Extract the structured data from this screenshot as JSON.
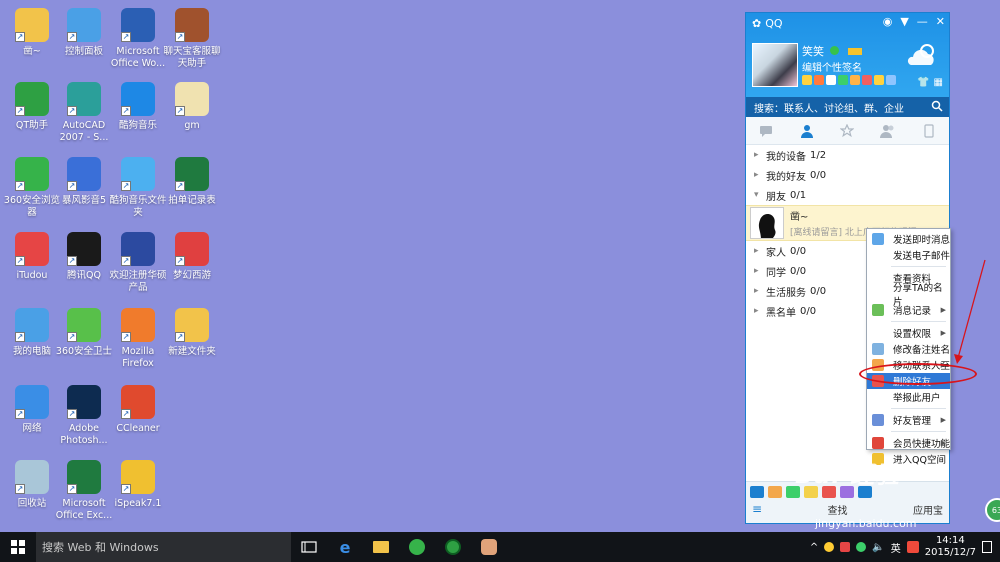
{
  "desktop": {
    "icons": [
      {
        "label": "凿~",
        "icon": "folder-user-icon"
      },
      {
        "label": "控制面板",
        "icon": "control-panel-icon"
      },
      {
        "label": "Microsoft Office Wo...",
        "icon": "word-icon"
      },
      {
        "label": "聊天宝客服聊天助手",
        "icon": "bear-icon"
      },
      {
        "label": "QT助手",
        "icon": "qt-icon"
      },
      {
        "label": "AutoCAD 2007 - S...",
        "icon": "autocad-icon"
      },
      {
        "label": "酷狗音乐",
        "icon": "kugou-icon"
      },
      {
        "label": "gm",
        "icon": "file-icon"
      },
      {
        "label": "360安全浏览器",
        "icon": "360-browser-icon"
      },
      {
        "label": "暴风影音5",
        "icon": "baofeng-icon"
      },
      {
        "label": "酷狗音乐文件夹",
        "icon": "kugou-folder-icon"
      },
      {
        "label": "拍单记录表",
        "icon": "excel-icon"
      },
      {
        "label": "iTudou",
        "icon": "itudou-icon"
      },
      {
        "label": "腾讯QQ",
        "icon": "qq-penguin-icon"
      },
      {
        "label": "欢迎注册华硕产品",
        "icon": "asus-icon"
      },
      {
        "label": "梦幻西游",
        "icon": "game-icon"
      },
      {
        "label": "我的电脑",
        "icon": "computer-icon"
      },
      {
        "label": "360安全卫士",
        "icon": "360-guard-icon"
      },
      {
        "label": "Mozilla Firefox",
        "icon": "firefox-icon"
      },
      {
        "label": "新建文件夹",
        "icon": "folder-icon"
      },
      {
        "label": "网络",
        "icon": "network-icon"
      },
      {
        "label": "Adobe Photosh...",
        "icon": "photoshop-icon"
      },
      {
        "label": "CCleaner",
        "icon": "ccleaner-icon"
      },
      {
        "label": "回收站",
        "icon": "recycle-bin-icon"
      },
      {
        "label": "Microsoft Office Exc...",
        "icon": "excel-icon"
      },
      {
        "label": "iSpeak7.1",
        "icon": "ispeak-icon"
      }
    ]
  },
  "taskbar": {
    "search_placeholder": "搜索 Web 和 Windows",
    "ime": "英",
    "time": "14:14",
    "date": "2015/12/7"
  },
  "qq": {
    "title": "QQ",
    "nickname": "笑笑",
    "signature": "编辑个性签名",
    "search_placeholder": "搜索：联系人、讨论组、群、企业",
    "groups": [
      {
        "name": "我的设备",
        "count": "1/2",
        "expanded": false
      },
      {
        "name": "我的好友",
        "count": "0/0",
        "expanded": false
      },
      {
        "name": "朋友",
        "count": "0/1",
        "expanded": true
      },
      {
        "name": "家人",
        "count": "0/0",
        "expanded": false
      },
      {
        "name": "同学",
        "count": "0/0",
        "expanded": false
      },
      {
        "name": "生活服务",
        "count": "0/0",
        "expanded": false
      },
      {
        "name": "黑名单",
        "count": "0/0",
        "expanded": false
      }
    ],
    "friend": {
      "name": "凿~",
      "message": "[离线请留言] 北上广不相信眼泪"
    },
    "bottom": {
      "find_label": "查找",
      "app_label": "应用宝"
    }
  },
  "context_menu": {
    "items": [
      {
        "label": "发送即时消息",
        "has_sub": false,
        "highlighted": false
      },
      {
        "label": "发送电子邮件",
        "has_sub": false,
        "highlighted": false
      },
      {
        "label": "查看资料",
        "has_sub": false,
        "highlighted": false
      },
      {
        "label": "分享TA的名片",
        "has_sub": false,
        "highlighted": false
      },
      {
        "label": "消息记录",
        "has_sub": true,
        "highlighted": false
      },
      {
        "label": "设置权限",
        "has_sub": true,
        "highlighted": false
      },
      {
        "label": "修改备注姓名",
        "has_sub": false,
        "highlighted": false
      },
      {
        "label": "移动联系人至",
        "has_sub": true,
        "highlighted": false
      },
      {
        "label": "删除好友",
        "has_sub": false,
        "highlighted": true
      },
      {
        "label": "举报此用户",
        "has_sub": false,
        "highlighted": false
      },
      {
        "label": "好友管理",
        "has_sub": true,
        "highlighted": false
      },
      {
        "label": "会员快捷功能",
        "has_sub": true,
        "highlighted": false
      },
      {
        "label": "进入QQ空间",
        "has_sub": false,
        "highlighted": false
      }
    ]
  },
  "watermark": {
    "brand": "Bai 经验",
    "url": "jingyan.baidu.com"
  },
  "float_ball_text": "63"
}
